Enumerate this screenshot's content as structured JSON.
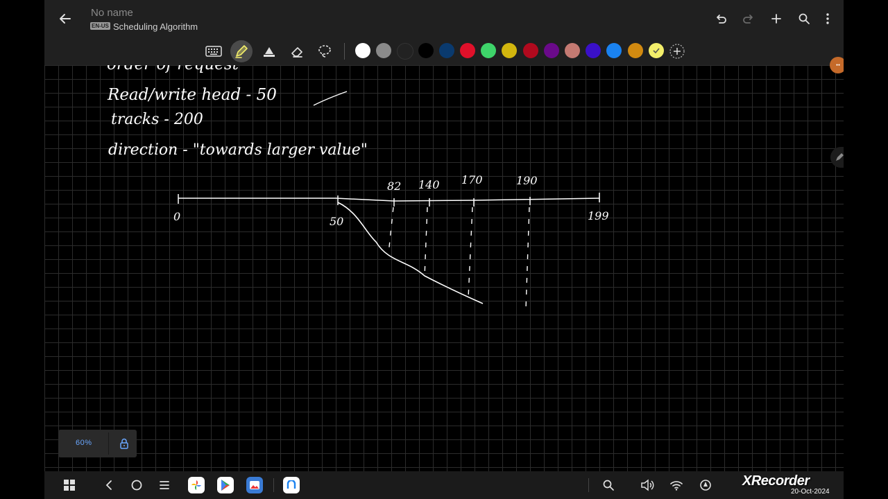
{
  "header": {
    "title": "No name",
    "language_badge": "EN-US",
    "subtitle": "Scheduling Algorithm",
    "icons": [
      "back-arrow-icon",
      "undo-icon",
      "redo-icon",
      "add-icon",
      "search-icon",
      "more-icon"
    ]
  },
  "toolbar": {
    "tools": [
      "keyboard-icon",
      "pen-icon",
      "highlighter-icon",
      "eraser-icon",
      "lasso-icon"
    ],
    "active_tool": "pen-icon",
    "colors": [
      "#ffffff",
      "#8a8a8a",
      "#222222",
      "#000000",
      "#0a3a6e",
      "#e0102a",
      "#3ed46a",
      "#d2b60e",
      "#b10a1e",
      "#6a0a8a",
      "#c47a72",
      "#3a10c8",
      "#1a82f0",
      "#d28a10",
      "#f3ee6a"
    ],
    "selected_color": "#f3ee6a"
  },
  "note": {
    "line1_partial": "order of request",
    "line2": "Read/write head - 50",
    "line3": "tracks - 200",
    "line4": "direction - \"towards larger value\"",
    "axis": {
      "start": "0",
      "end": "199",
      "head": "50",
      "requests": [
        "82",
        "140",
        "170",
        "190"
      ]
    }
  },
  "zoom": {
    "label": "60%"
  },
  "taskbar": {
    "icons": [
      "apps-grid-icon",
      "back-icon",
      "home-icon",
      "recents-icon",
      "photos-app-icon",
      "play-store-icon",
      "gallery-app-icon",
      "notes-app-icon",
      "search-icon",
      "volume-icon",
      "wifi-icon",
      "location-icon"
    ],
    "watermark": "XRecorder",
    "date": "20-Oct-2024"
  }
}
